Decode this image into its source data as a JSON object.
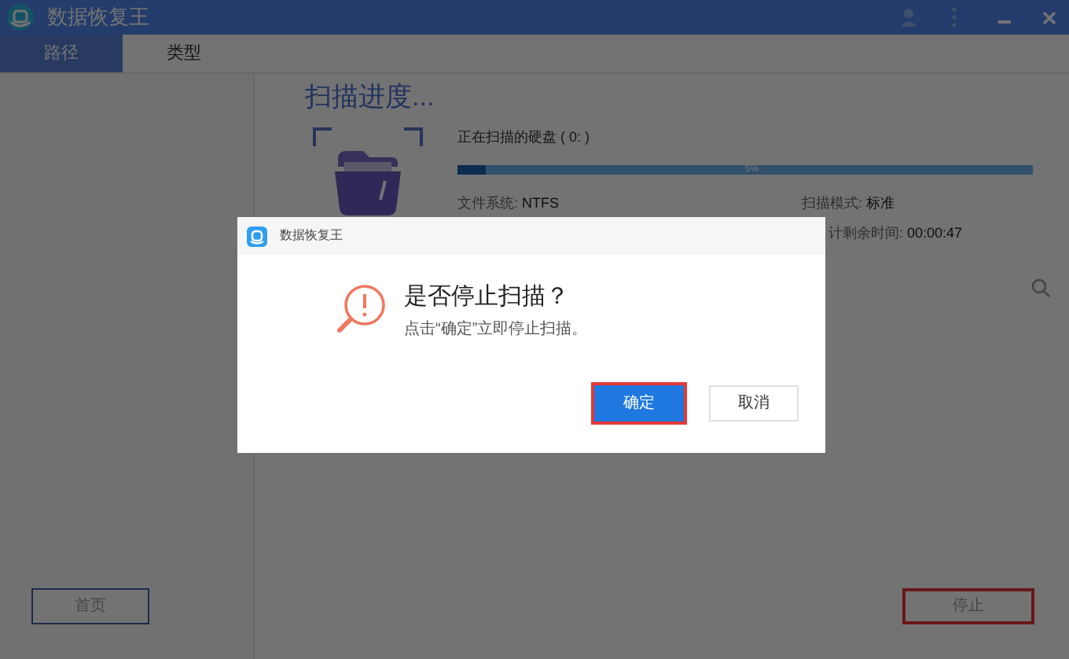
{
  "window": {
    "title": "数据恢复王"
  },
  "tabs": [
    {
      "label": "路径",
      "selected": true
    },
    {
      "label": "类型",
      "selected": false
    }
  ],
  "scan": {
    "heading": "扫描进度...",
    "disk_label": "正在扫描的硬盘 ( 0: )",
    "progress": {
      "level": 0.05,
      "reading": "5%"
    },
    "filesystem": {
      "label": "文件系统:",
      "value": "NTFS"
    },
    "mode": {
      "label": "扫描模式:",
      "value": "标准"
    },
    "remaining": {
      "label": "计剩余时间:",
      "value": "00:00:47"
    }
  },
  "footer_buttons": [
    {
      "label": "首页",
      "highlighted": false
    },
    {
      "label": "停止",
      "highlighted": true
    }
  ],
  "dialog": {
    "title": "数据恢复王",
    "heading": "是否停止扫描？",
    "message": "点击“确定”立即停止扫描。",
    "buttons": [
      {
        "label": "确定",
        "kind": "primary",
        "highlighted": true
      },
      {
        "label": "取消",
        "kind": "secondary",
        "highlighted": false
      }
    ]
  }
}
